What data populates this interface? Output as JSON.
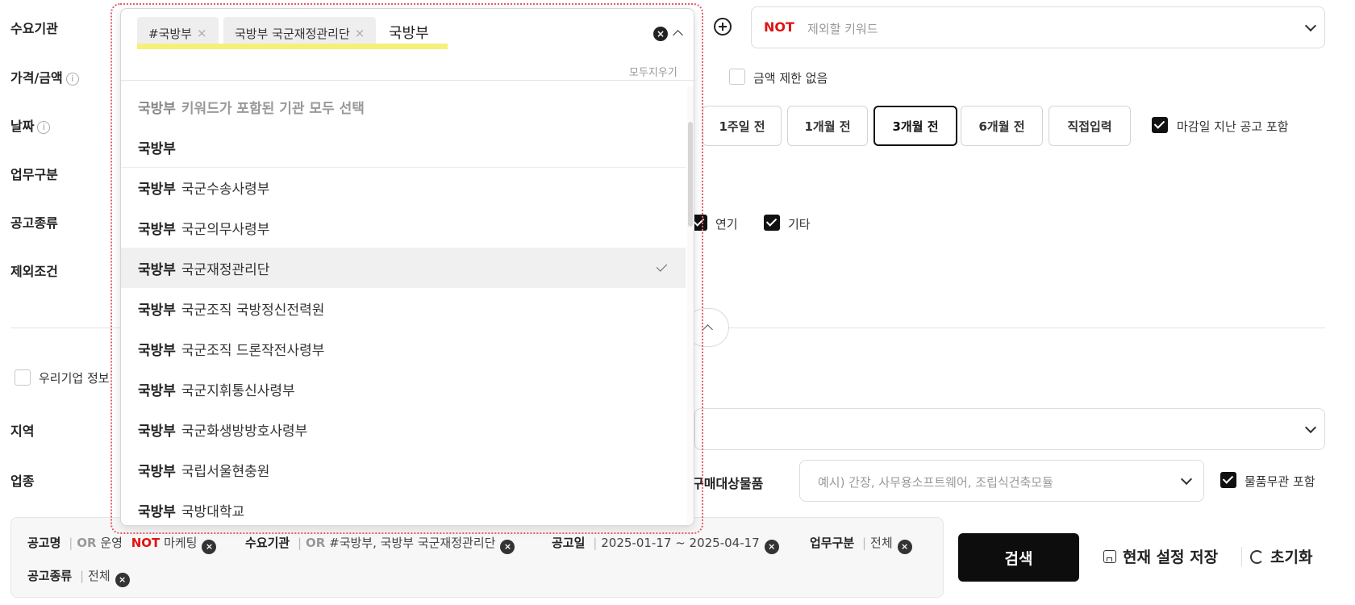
{
  "labels": {
    "agency": "수요기관",
    "price": "가격/금액",
    "date": "날짜",
    "business_type": "업무구분",
    "notice_type": "공고종류",
    "exclusion": "제외조건",
    "region": "지역",
    "industry": "업종"
  },
  "info_icon": "i",
  "not_keyword": {
    "badge": "NOT",
    "placeholder": "제외할 키워드"
  },
  "price": {
    "no_limit_label": "금액 제한 없음"
  },
  "date_buttons": [
    "1주일 전",
    "1개월 전",
    "3개월 전",
    "6개월 전",
    "직접입력"
  ],
  "date_selected": "3개월 전",
  "include_closed_label": "마감일 지난 공고 포함",
  "notice_types": {
    "yeongi": "연기",
    "gita": "기타"
  },
  "company_info_label": "우리기업 정보",
  "purchase": {
    "label": "구매대상물품",
    "placeholder": "예시) 간장, 사무용소프트웨어, 조립식건축모듈",
    "goods_irrelevant_label": "물품무관 포함"
  },
  "dropdown": {
    "tags": [
      "#국방부",
      "국방부 국군재정관리단"
    ],
    "tag_remove": "×",
    "input_value": "국방부",
    "clear_all": "모두지우기",
    "clear_icon": "×",
    "select_all": {
      "keyword": "국방부",
      "text": "키워드가 포함된 기관 모두 선택"
    },
    "items": [
      {
        "bold": "국방부",
        "rest": ""
      },
      {
        "bold": "국방부",
        "rest": "국군수송사령부"
      },
      {
        "bold": "국방부",
        "rest": "국군의무사령부"
      },
      {
        "bold": "국방부",
        "rest": "국군재정관리단"
      },
      {
        "bold": "국방부",
        "rest": "국군조직 국방정신전력원"
      },
      {
        "bold": "국방부",
        "rest": "국군조직 드론작전사령부"
      },
      {
        "bold": "국방부",
        "rest": "국군지휘통신사령부"
      },
      {
        "bold": "국방부",
        "rest": "국군화생방방호사령부"
      },
      {
        "bold": "국방부",
        "rest": "국립서울현충원"
      },
      {
        "bold": "국방부",
        "rest": "국방대학교"
      }
    ]
  },
  "applied_filters": {
    "title": {
      "key": "공고명",
      "or": "OR",
      "or_value": "운영",
      "not": "NOT",
      "not_value": "마케팅"
    },
    "agency": {
      "key": "수요기관",
      "or": "OR",
      "value": "#국방부, 국방부 국군재정관리단"
    },
    "notice_date": {
      "key": "공고일",
      "value": "2025-01-17 ~ 2025-04-17"
    },
    "business": {
      "key": "업무구분",
      "value": "전체"
    },
    "notice_type": {
      "key": "공고종류",
      "value": "전체"
    },
    "remove_icon": "×"
  },
  "actions": {
    "search": "검색",
    "save": "현재 설정 저장",
    "reset": "초기화"
  }
}
